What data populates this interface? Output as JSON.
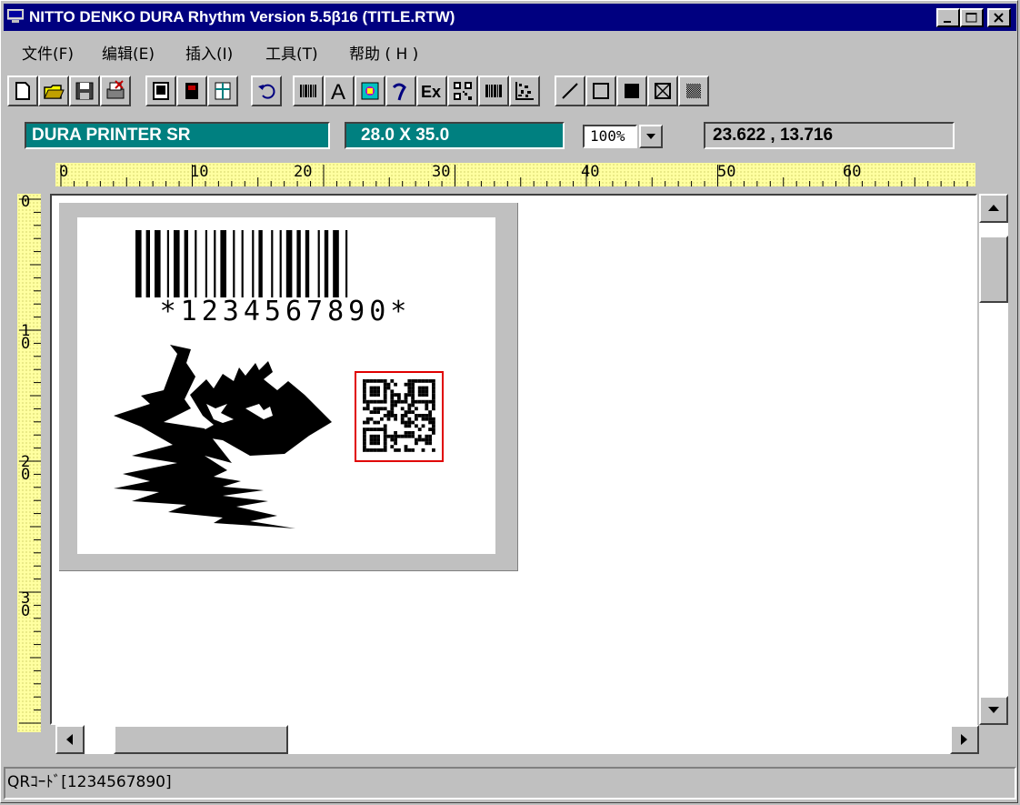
{
  "window": {
    "title": "NITTO DENKO  DURA Rhythm Version 5.5β16 (TITLE.RTW)"
  },
  "menu": [
    "文件(F)",
    "编辑(E)",
    "插入(I)",
    "工具(T)",
    "帮助 ( H )"
  ],
  "toolbar_icons": [
    "new-file-icon",
    "open-folder-icon",
    "save-icon",
    "print-icon",
    "page-setup-icon",
    "printer-icon",
    "layout-icon",
    "undo-icon",
    "barcode-icon",
    "text-tool-icon",
    "image-tool-icon",
    "logo-tool-icon",
    "excel-icon",
    "qr-code-icon",
    "barcode2-icon",
    "datamatrix-icon",
    "line-tool-icon",
    "rectangle-tool-icon",
    "filled-rect-tool-icon",
    "cross-box-tool-icon",
    "pattern-fill-tool-icon"
  ],
  "status_fields": {
    "printer": "DURA PRINTER SR",
    "size": "28.0 X  35.0",
    "zoom": "100%",
    "coordinates": "23.622 , 13.716"
  },
  "rulers": {
    "horizontal": [
      "0",
      "10",
      "20",
      "30",
      "40",
      "50",
      "60"
    ],
    "vertical": [
      "0",
      "1\n0",
      "2\n0",
      "3\n0"
    ]
  },
  "label": {
    "barcode_text": "*1234567890*"
  },
  "statusbar": {
    "text": "QRｺｰﾄﾞ[1234567890]"
  },
  "colors": {
    "title_bar": "#000080",
    "teal_field": "#008080",
    "ruler": "#ffffa0",
    "selection": "#e00000"
  }
}
